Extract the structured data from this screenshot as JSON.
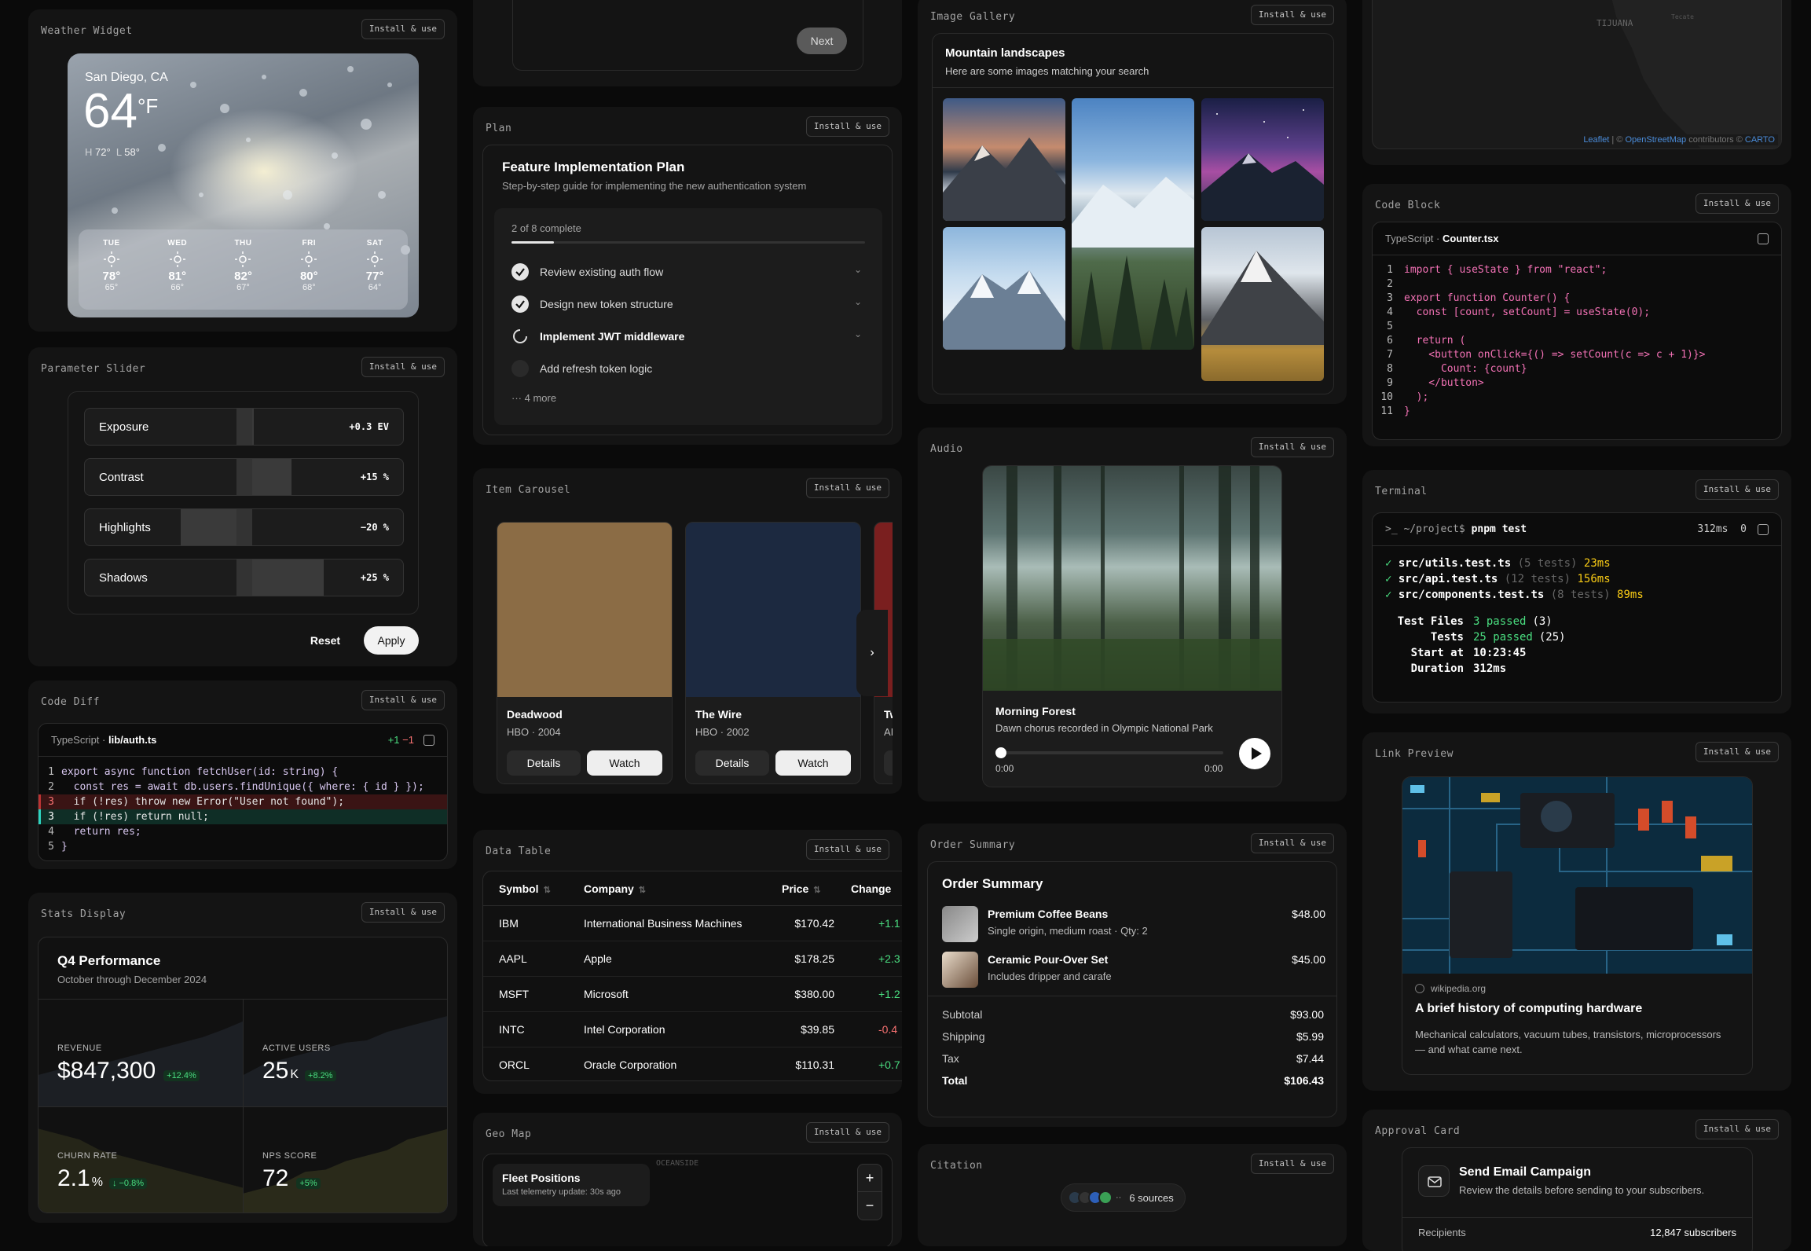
{
  "install_label": "Install & use",
  "weather": {
    "title": "Weather Widget",
    "city": "San Diego, CA",
    "temp": "64",
    "unit": "°F",
    "high": "72°",
    "low": "58°",
    "h_label": "H",
    "l_label": "L",
    "forecast": [
      {
        "day": "TUE",
        "icon": "sun-icon",
        "hi": "78°",
        "lo": "65°"
      },
      {
        "day": "WED",
        "icon": "sun-icon",
        "hi": "81°",
        "lo": "66°"
      },
      {
        "day": "THU",
        "icon": "partly-cloudy-icon",
        "hi": "82°",
        "lo": "67°"
      },
      {
        "day": "FRI",
        "icon": "sun-icon",
        "hi": "80°",
        "lo": "68°"
      },
      {
        "day": "SAT",
        "icon": "partly-cloudy-icon",
        "hi": "77°",
        "lo": "64°"
      }
    ]
  },
  "slider": {
    "title": "Parameter Slider",
    "params": [
      {
        "label": "Exposure",
        "value": "+0.3 EV",
        "amount": 0.03
      },
      {
        "label": "Contrast",
        "value": "+15 %",
        "amount": 0.15
      },
      {
        "label": "Highlights",
        "value": "−20 %",
        "amount": -0.2
      },
      {
        "label": "Shadows",
        "value": "+25 %",
        "amount": 0.25
      }
    ],
    "reset": "Reset",
    "apply": "Apply"
  },
  "diff": {
    "title": "Code Diff",
    "lang": "TypeScript",
    "sep": "·",
    "file": "lib/auth.ts",
    "added": "+1",
    "removed": "−1",
    "lines": [
      {
        "n": "1",
        "type": "ctx",
        "code": "export async function fetchUser(id: string) {"
      },
      {
        "n": "2",
        "type": "ctx",
        "code": "  const res = await db.users.findUnique({ where: { id } });"
      },
      {
        "n": "3",
        "type": "del",
        "code": "  if (!res) throw new Error(\"User not found\");"
      },
      {
        "n": "3",
        "type": "add",
        "code": "  if (!res) return null;"
      },
      {
        "n": "4",
        "type": "ctx",
        "code": "  return res;"
      },
      {
        "n": "5",
        "type": "ctx",
        "code": "}"
      }
    ]
  },
  "stats": {
    "title": "Stats Display",
    "heading": "Q4 Performance",
    "sub": "October through December 2024",
    "items": [
      {
        "label": "REVENUE",
        "value": "$847,300",
        "suffix": "",
        "delta": "+12.4%",
        "trend": [
          0.3,
          0.35,
          0.32,
          0.4,
          0.45,
          0.5,
          0.55,
          0.6,
          0.65,
          0.72,
          0.8
        ]
      },
      {
        "label": "ACTIVE USERS",
        "value": "25",
        "suffix": "K",
        "delta": "+8.2%",
        "trend": [
          0.3,
          0.4,
          0.45,
          0.5,
          0.55,
          0.6,
          0.62,
          0.7,
          0.75,
          0.8,
          0.85
        ]
      },
      {
        "label": "CHURN RATE",
        "value": "2.1",
        "suffix": "%",
        "delta": "↓ −0.8%",
        "trend": [
          0.8,
          0.75,
          0.7,
          0.6,
          0.55,
          0.5,
          0.45,
          0.4,
          0.35,
          0.3,
          0.25
        ]
      },
      {
        "label": "NPS SCORE",
        "value": "72",
        "suffix": "",
        "delta": "+5%",
        "trend": [
          0.2,
          0.25,
          0.3,
          0.4,
          0.42,
          0.5,
          0.55,
          0.6,
          0.7,
          0.75,
          0.8
        ]
      }
    ]
  },
  "form": {
    "next": "Next"
  },
  "plan": {
    "title": "Plan",
    "heading": "Feature Implementation Plan",
    "sub": "Step-by-step guide for implementing the new authentication system",
    "progress_text": "2 of 8 complete",
    "progress": 0.25,
    "steps": [
      {
        "label": "Review existing auth flow",
        "status": "done"
      },
      {
        "label": "Design new token structure",
        "status": "done"
      },
      {
        "label": "Implement JWT middleware",
        "status": "active"
      },
      {
        "label": "Add refresh token logic",
        "status": "todo"
      }
    ],
    "more": "4 more"
  },
  "carousel": {
    "title": "Item Carousel",
    "items": [
      {
        "name": "Deadwood",
        "meta": "HBO · 2004",
        "color": "#8b6c45"
      },
      {
        "name": "The Wire",
        "meta": "HBO · 2002",
        "color": "#1c2940"
      },
      {
        "name": "Tw",
        "meta": "AI",
        "color": "#7a1f1f"
      }
    ],
    "details": "Details",
    "watch": "Watch"
  },
  "table": {
    "title": "Data Table",
    "columns": [
      "Symbol",
      "Company",
      "Price",
      "Change"
    ],
    "rows": [
      {
        "symbol": "IBM",
        "company": "International Business Machines",
        "price": "$170.42",
        "change": "+1.1",
        "dir": "up"
      },
      {
        "symbol": "AAPL",
        "company": "Apple",
        "price": "$178.25",
        "change": "+2.3",
        "dir": "up"
      },
      {
        "symbol": "MSFT",
        "company": "Microsoft",
        "price": "$380.00",
        "change": "+1.2",
        "dir": "up"
      },
      {
        "symbol": "INTC",
        "company": "Intel Corporation",
        "price": "$39.85",
        "change": "-0.4",
        "dir": "down"
      },
      {
        "symbol": "ORCL",
        "company": "Oracle Corporation",
        "price": "$110.31",
        "change": "+0.7",
        "dir": "up"
      }
    ]
  },
  "geo": {
    "title": "Geo Map",
    "heading": "Fleet Positions",
    "sub": "Last telemetry update: 30s ago",
    "place": "OCEANSIDE",
    "zoom_in": "+",
    "zoom_out": "−"
  },
  "gallery": {
    "title": "Image Gallery",
    "heading": "Mountain landscapes",
    "sub": "Here are some images matching your search"
  },
  "audio": {
    "title": "Audio",
    "track": "Morning Forest",
    "desc": "Dawn chorus recorded in Olympic National Park",
    "elapsed": "0:00",
    "total": "0:00",
    "progress": 0
  },
  "order": {
    "title": "Order Summary",
    "heading": "Order Summary",
    "items": [
      {
        "name": "Premium Coffee Beans",
        "desc": "Single origin, medium roast · Qty: 2",
        "price": "$48.00"
      },
      {
        "name": "Ceramic Pour-Over Set",
        "desc": "Includes dripper and carafe",
        "price": "$45.00"
      }
    ],
    "subtotal_label": "Subtotal",
    "subtotal": "$93.00",
    "shipping_label": "Shipping",
    "shipping": "$5.99",
    "tax_label": "Tax",
    "tax": "$7.44",
    "total_label": "Total",
    "total": "$106.43"
  },
  "citation": {
    "title": "Citation",
    "sources": "6 sources",
    "more": "··"
  },
  "map_top": {
    "place": "TIJUANA",
    "place2": "Tecate",
    "attr_leaflet": "Leaflet",
    "attr_sep": " | © ",
    "attr_osm": "OpenStreetMap",
    "attr_contrib": " contributors © ",
    "attr_carto": "CARTO"
  },
  "codeblock": {
    "title": "Code Block",
    "lang": "TypeScript",
    "sep": "·",
    "file": "Counter.tsx",
    "lines": [
      {
        "n": "1",
        "code": "import { useState } from \"react\";"
      },
      {
        "n": "2",
        "code": ""
      },
      {
        "n": "3",
        "code": "export function Counter() {"
      },
      {
        "n": "4",
        "code": "  const [count, setCount] = useState(0);"
      },
      {
        "n": "5",
        "code": ""
      },
      {
        "n": "6",
        "code": "  return ("
      },
      {
        "n": "7",
        "code": "    <button onClick={() => setCount(c => c + 1)}>"
      },
      {
        "n": "8",
        "code": "      Count: {count}"
      },
      {
        "n": "9",
        "code": "    </button>"
      },
      {
        "n": "10",
        "code": "  );"
      },
      {
        "n": "11",
        "code": "}"
      }
    ]
  },
  "terminal": {
    "title": "Terminal",
    "prompt": ">_ ~/project$",
    "cmd": "pnpm test",
    "time": "312ms",
    "exit": "0",
    "results": [
      {
        "check": "✓",
        "file": "src/utils.test.ts",
        "count": "(5 tests)",
        "ms": "23ms"
      },
      {
        "check": "✓",
        "file": "src/api.test.ts",
        "count": "(12 tests)",
        "ms": "156ms"
      },
      {
        "check": "✓",
        "file": "src/components.test.ts",
        "count": "(8 tests)",
        "ms": "89ms"
      }
    ],
    "summary": [
      {
        "k": "Test Files",
        "v": "3 passed",
        "extra": "(3)"
      },
      {
        "k": "Tests",
        "v": "25 passed",
        "extra": "(25)"
      },
      {
        "k": "Start at",
        "v": "10:23:45",
        "extra": ""
      },
      {
        "k": "Duration",
        "v": "312ms",
        "extra": ""
      }
    ]
  },
  "link": {
    "title": "Link Preview",
    "domain": "wikipedia.org",
    "heading": "A brief history of computing hardware",
    "desc": "Mechanical calculators, vacuum tubes, transistors, microprocessors — and what came next."
  },
  "approval": {
    "title": "Approval Card",
    "heading": "Send Email Campaign",
    "sub": "Review the details before sending to your subscribers.",
    "row_label": "Recipients",
    "row_value": "12,847 subscribers"
  }
}
